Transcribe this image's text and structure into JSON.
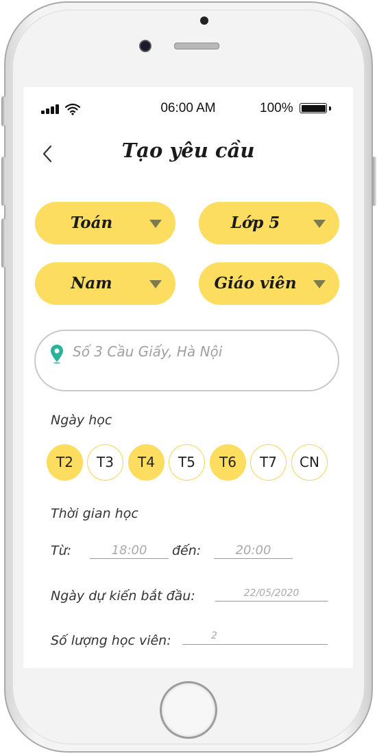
{
  "status_bar": {
    "time": "06:00 AM",
    "battery": "100%"
  },
  "header": {
    "title": "Tạo yêu cầu"
  },
  "filters": {
    "subject": "Toán",
    "grade": "Lớp 5",
    "gender": "Nam",
    "tutor_type": "Giáo viên"
  },
  "address": {
    "value": "Số 3 Cầu Giấy, Hà Nội"
  },
  "schedule": {
    "days_label": "Ngày học",
    "days": [
      {
        "label": "T2",
        "selected": true
      },
      {
        "label": "T3",
        "selected": false
      },
      {
        "label": "T4",
        "selected": true
      },
      {
        "label": "T5",
        "selected": false
      },
      {
        "label": "T6",
        "selected": true
      },
      {
        "label": "T7",
        "selected": false
      },
      {
        "label": "CN",
        "selected": false
      }
    ],
    "time_label": "Thời gian học",
    "from_label": "Từ:",
    "from_value": "18:00",
    "to_label": "đến:",
    "to_value": "20:00",
    "start_date_label": "Ngày dự kiến bắt đầu:",
    "start_date_value": "22/05/2020",
    "student_count_label": "Số lượng học viên:",
    "student_count_value": "2"
  },
  "colors": {
    "accent": "#fcdd5f",
    "pin": "#2bb39a"
  }
}
